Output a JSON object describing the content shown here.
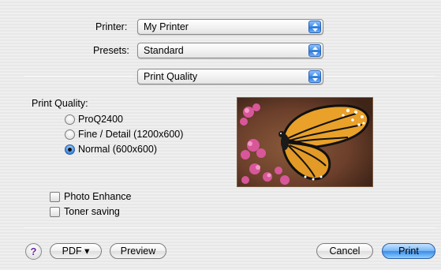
{
  "printer": {
    "label": "Printer:",
    "value": "My Printer"
  },
  "presets": {
    "label": "Presets:",
    "value": "Standard"
  },
  "panel_menu": {
    "value": "Print Quality"
  },
  "print_quality": {
    "label": "Print Quality:",
    "options": [
      {
        "label": "ProQ2400",
        "selected": false
      },
      {
        "label": "Fine / Detail (1200x600)",
        "selected": false
      },
      {
        "label": "Normal (600x600)",
        "selected": true
      }
    ]
  },
  "checkboxes": [
    {
      "label": "Photo Enhance",
      "checked": false
    },
    {
      "label": "Toner saving",
      "checked": false
    }
  ],
  "buttons": {
    "help": "?",
    "pdf": "PDF ▾",
    "preview": "Preview",
    "cancel": "Cancel",
    "print": "Print"
  },
  "icons": {
    "popup_arrows": "up-down-arrows-icon",
    "help": "question-mark-icon",
    "preview_image": "butterfly-image"
  },
  "colors": {
    "accent_blue": "#3d8ce6",
    "help_glyph": "#6b2aa0",
    "background": "#ececec"
  }
}
